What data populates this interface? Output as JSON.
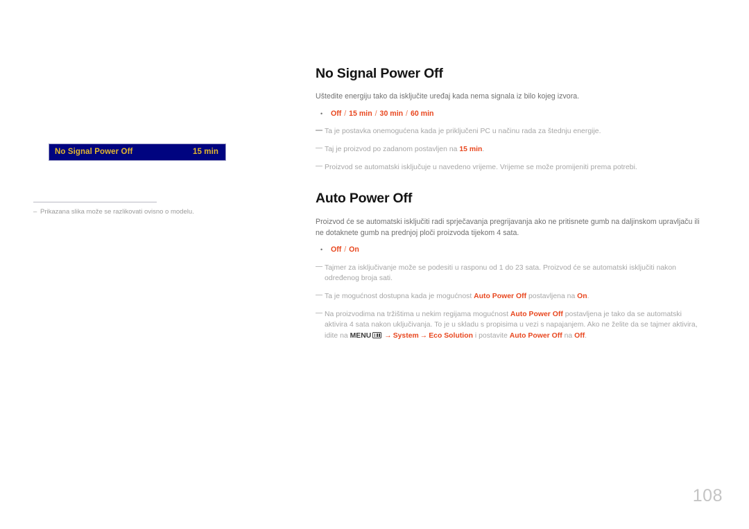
{
  "page": {
    "number": "108",
    "language": "hr"
  },
  "osd_preview": {
    "label": "No Signal Power Off",
    "value": "15 min",
    "background_color": "#000480",
    "text_color": "#e3b72e"
  },
  "left_footnote": {
    "dash": "–",
    "text": "Prikazana slika može se razlikovati ovisno o modelu."
  },
  "sections": [
    {
      "title": "No Signal Power Off",
      "intro": "Uštedite energiju tako da isključite uređaj kada nema signala iz bilo kojeg izvora.",
      "bullet": {
        "dot": "•",
        "options": [
          "Off",
          "15 min",
          "30 min",
          "60 min"
        ],
        "separator": "/"
      },
      "notes": [
        {
          "parts": [
            {
              "text": "Ta je postavka onemogućena kada je priključeni PC u načinu rada za štednju energije.",
              "style": "plain"
            }
          ]
        },
        {
          "parts": [
            {
              "text": "Taj je proizvod po zadanom postavljen na ",
              "style": "plain"
            },
            {
              "text": "15 min",
              "style": "accent"
            },
            {
              "text": ".",
              "style": "plain"
            }
          ]
        },
        {
          "parts": [
            {
              "text": "Proizvod se automatski isključuje u navedeno vrijeme. Vrijeme se može promijeniti prema potrebi.",
              "style": "plain"
            }
          ]
        }
      ]
    },
    {
      "title": "Auto Power Off",
      "intro": "Proizvod će se automatski isključiti radi sprječavanja pregrijavanja ako ne pritisnete gumb na daljinskom upravljaču ili ne dotaknete gumb na prednjoj ploči proizvoda tijekom 4 sata.",
      "bullet": {
        "dot": "•",
        "options": [
          "Off",
          "On"
        ],
        "separator": "/"
      },
      "notes": [
        {
          "parts": [
            {
              "text": "Tajmer za isključivanje može se podesiti u rasponu od 1 do 23 sata. Proizvod će se automatski isključiti nakon određenog broja sati.",
              "style": "plain"
            }
          ]
        },
        {
          "parts": [
            {
              "text": "Ta je mogućnost dostupna kada je mogućnost ",
              "style": "plain"
            },
            {
              "text": "Auto Power Off",
              "style": "accent"
            },
            {
              "text": " postavljena na ",
              "style": "plain"
            },
            {
              "text": "On",
              "style": "accent"
            },
            {
              "text": ".",
              "style": "plain"
            }
          ]
        },
        {
          "parts": [
            {
              "text": "Na proizvodima na tržištima u nekim regijama mogućnost ",
              "style": "plain"
            },
            {
              "text": "Auto Power Off",
              "style": "accent"
            },
            {
              "text": " postavljena je tako da se automatski aktivira 4 sata nakon uključivanja. To je u skladu s propisima u vezi s napajanjem. Ako ne želite da se tajmer aktivira, idite na ",
              "style": "plain"
            },
            {
              "text": "MENU",
              "style": "dark"
            },
            {
              "text": "menu-icon",
              "style": "icon"
            },
            {
              "text": "→",
              "style": "arrow"
            },
            {
              "text": "System",
              "style": "accent"
            },
            {
              "text": "→",
              "style": "arrow"
            },
            {
              "text": "Eco Solution",
              "style": "accent"
            },
            {
              "text": " i postavite ",
              "style": "plain"
            },
            {
              "text": "Auto Power Off",
              "style": "accent"
            },
            {
              "text": " na ",
              "style": "plain"
            },
            {
              "text": "Off",
              "style": "accent"
            },
            {
              "text": ".",
              "style": "plain"
            }
          ]
        }
      ]
    }
  ],
  "colors": {
    "accent_red": "#e8471f",
    "note_gray": "#a6a6a6",
    "body_gray": "#6f6f6f",
    "heading_black": "#141414",
    "page_number_gray": "#c4c4c4"
  }
}
